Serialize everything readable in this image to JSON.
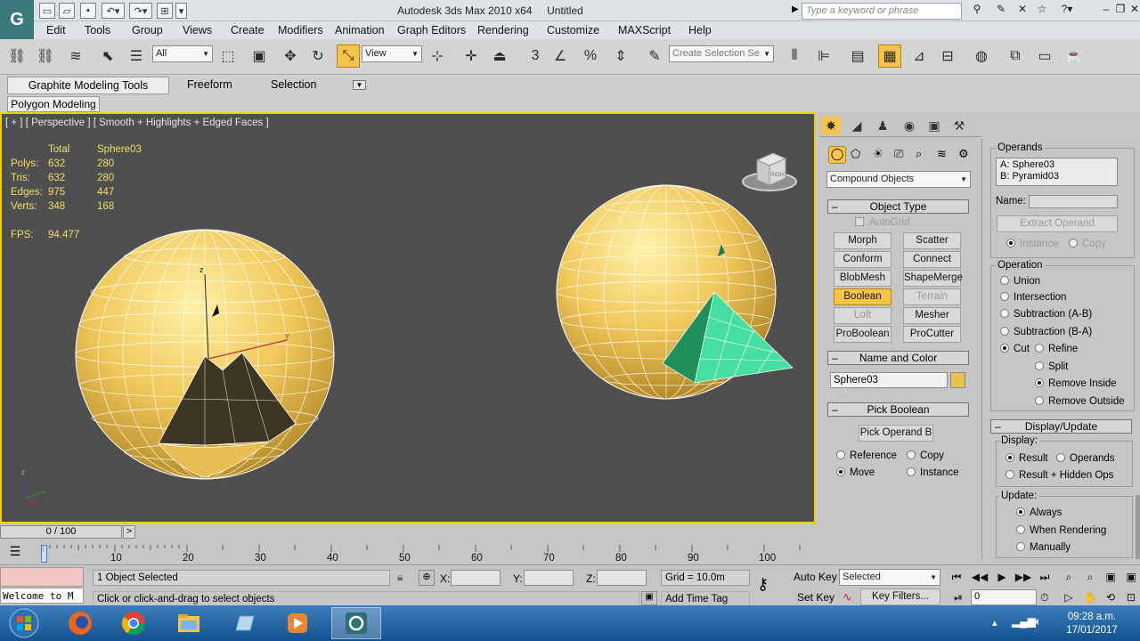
{
  "window": {
    "app_title": "Autodesk 3ds Max  2010 x64",
    "doc_title": "Untitled",
    "search_placeholder": "Type a keyword or phrase",
    "app_icon_glyph": "G"
  },
  "menu": [
    "Edit",
    "Tools",
    "Group",
    "Views",
    "Create",
    "Modifiers",
    "Animation",
    "Graph Editors",
    "Rendering",
    "Customize",
    "MAXScript",
    "Help"
  ],
  "toolbar": {
    "selection_filter": "All",
    "reference_coord": "View",
    "named_selection_placeholder": "Create Selection Se"
  },
  "ribbon": {
    "tabs": [
      "Graphite Modeling Tools",
      "Freeform",
      "Selection"
    ],
    "panel": "Polygon Modeling"
  },
  "viewport": {
    "label": "[ + ] [ Perspective ] [ Smooth + Highlights + Edged Faces ]",
    "stats": {
      "col_total": "Total",
      "col_object": "Sphere03",
      "rows": [
        {
          "label": "Polys:",
          "total": "632",
          "obj": "280"
        },
        {
          "label": "Tris:",
          "total": "632",
          "obj": "280"
        },
        {
          "label": "Edges:",
          "total": "975",
          "obj": "447"
        },
        {
          "label": "Verts:",
          "total": "348",
          "obj": "168"
        }
      ],
      "fps_label": "FPS:",
      "fps_value": "94.477"
    },
    "viewcube_label": "RIGHT",
    "axis_z": "z",
    "axis_y": "y"
  },
  "command_panel": {
    "category": "Compound Objects",
    "object_type": {
      "title": "Object Type",
      "autogrid": "AutoGrid",
      "buttons": [
        {
          "label": "Morph",
          "state": "normal"
        },
        {
          "label": "Scatter",
          "state": "normal"
        },
        {
          "label": "Conform",
          "state": "normal"
        },
        {
          "label": "Connect",
          "state": "normal"
        },
        {
          "label": "BlobMesh",
          "state": "normal"
        },
        {
          "label": "ShapeMerge",
          "state": "normal"
        },
        {
          "label": "Boolean",
          "state": "active"
        },
        {
          "label": "Terrain",
          "state": "disabled"
        },
        {
          "label": "Loft",
          "state": "disabled"
        },
        {
          "label": "Mesher",
          "state": "normal"
        },
        {
          "label": "ProBoolean",
          "state": "normal"
        },
        {
          "label": "ProCutter",
          "state": "normal"
        }
      ]
    },
    "name_and_color": {
      "title": "Name and Color",
      "name": "Sphere03",
      "color": "#e8c24e"
    },
    "pick_boolean": {
      "title": "Pick Boolean",
      "button": "Pick Operand B",
      "options": [
        {
          "label": "Reference",
          "checked": false
        },
        {
          "label": "Copy",
          "checked": false
        },
        {
          "label": "Move",
          "checked": true
        },
        {
          "label": "Instance",
          "checked": false
        }
      ]
    },
    "operands": {
      "title": "Operands",
      "items": [
        "A: Sphere03",
        "B: Pyramid03"
      ],
      "name_label": "Name:",
      "extract": "Extract Operand",
      "instance": "Instance",
      "copy": "Copy"
    },
    "operation": {
      "title": "Operation",
      "options": [
        {
          "label": "Union",
          "checked": false
        },
        {
          "label": "Intersection",
          "checked": false
        },
        {
          "label": "Subtraction (A-B)",
          "checked": false
        },
        {
          "label": "Subtraction (B-A)",
          "checked": false
        },
        {
          "label": "Cut",
          "checked": true
        }
      ],
      "cut_options": [
        {
          "label": "Refine",
          "checked": false
        },
        {
          "label": "Split",
          "checked": false
        },
        {
          "label": "Remove Inside",
          "checked": true
        },
        {
          "label": "Remove Outside",
          "checked": false
        }
      ]
    },
    "display_update": {
      "title": "Display/Update",
      "display_label": "Display:",
      "display_options": [
        {
          "label": "Result",
          "checked": true
        },
        {
          "label": "Operands",
          "checked": false
        },
        {
          "label": "Result + Hidden Ops",
          "checked": false
        }
      ],
      "update_label": "Update:",
      "update_options": [
        {
          "label": "Always",
          "checked": true
        },
        {
          "label": "When Rendering",
          "checked": false
        },
        {
          "label": "Manually",
          "checked": false
        }
      ]
    }
  },
  "timeline": {
    "frame": "0 / 100",
    "next": ">",
    "ticks": [
      "10",
      "20",
      "30",
      "40",
      "50",
      "60",
      "70",
      "80",
      "90",
      "100"
    ]
  },
  "status": {
    "maxscript": "Welcome to M",
    "selected": "1 Object Selected",
    "prompt": "Click or click-and-drag to select objects",
    "x_label": "X:",
    "y_label": "Y:",
    "z_label": "Z:",
    "grid": "Grid = 10.0m",
    "add_time_tag": "Add Time Tag",
    "auto_key": "Auto Key",
    "set_key": "Set Key",
    "key_mode": "Selected",
    "key_filters": "Key Filters...",
    "current_frame": "0"
  },
  "taskbar": {
    "time": "09:28 a.m.",
    "date": "17/01/2017"
  }
}
